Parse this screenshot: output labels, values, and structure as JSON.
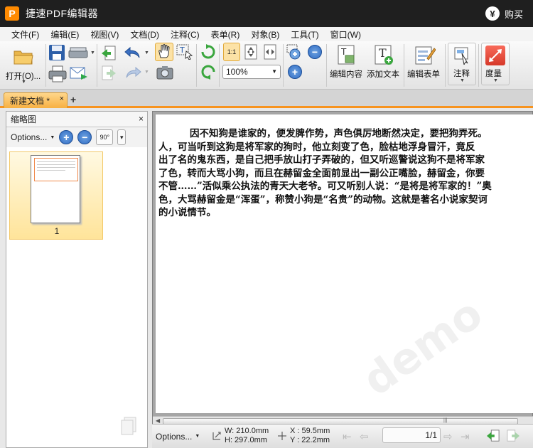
{
  "app": {
    "title": "捷速PDF编辑器",
    "logo_letter": "P",
    "buy_label": "购买"
  },
  "menu": [
    "文件(F)",
    "编辑(E)",
    "视图(V)",
    "文档(D)",
    "注释(C)",
    "表单(R)",
    "对象(B)",
    "工具(T)",
    "窗口(W)"
  ],
  "toolbar": {
    "open_label": "打开(O)...",
    "zoom_value": "100%",
    "edit_content_label": "编辑内容",
    "add_text_label": "添加文本",
    "edit_form_label": "编辑表单",
    "annotate_label": "注释",
    "measure_label": "度量"
  },
  "tabs": [
    {
      "label": "新建文档 *",
      "close": "×"
    }
  ],
  "add_tab_symbol": "+",
  "thumbnail_panel": {
    "title": "缩略图",
    "close": "×",
    "options_label": "Options...",
    "rotate_label": "90°",
    "pages": [
      {
        "number": "1"
      }
    ]
  },
  "document": {
    "lines": [
      "因不知狗是谁家的，便发脾作势，声色俱厉地断然决定，要把狗弄死。",
      "人，可当听到这狗是将军家的狗时，他立刻变了色，脸枯地浮身冒汗，竟反",
      "出了名的鬼东西，是自己把手放山打子弄破的，但又听巡警说这狗不是将军家",
      "了色，转而大骂小狗，而且在赫留金全面前显出一副公正嘴脸，赫留金，你要",
      "不管……”活似乘公执法的青天大老爷。可又听别人说：“是将是将军家的！”奥",
      "色，大骂赫留金是“浑蛋”，称赞小狗是“名贵”的动物。这就是著名小说家契诃",
      "的小说情节。"
    ],
    "watermark": "demo"
  },
  "statusbar": {
    "options_label": "Options...",
    "width": "W:  210.0mm",
    "height": "H:  297.0mm",
    "x": "X :    59.5mm",
    "y": "Y :    22.2mm",
    "page_indicator": "1/1"
  },
  "colors": {
    "accent": "#f7931e",
    "titlebar": "#1f1f1f",
    "selection": "#ffe49a"
  }
}
